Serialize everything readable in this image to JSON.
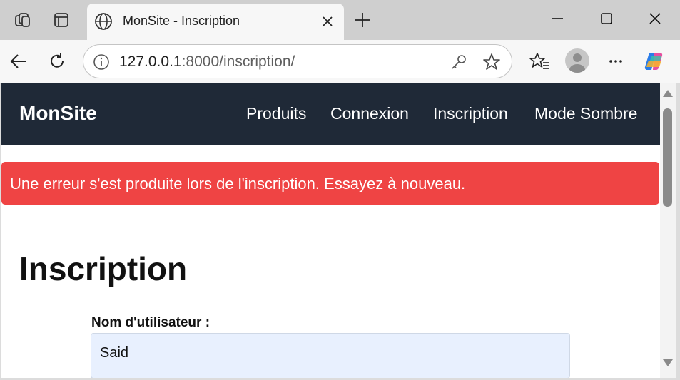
{
  "browser": {
    "tab": {
      "title": "MonSite - Inscription"
    },
    "address": {
      "host": "127.0.0.1",
      "rest": ":8000/inscription/"
    }
  },
  "site": {
    "brand": "MonSite",
    "nav": [
      {
        "label": "Produits"
      },
      {
        "label": "Connexion"
      },
      {
        "label": "Inscription"
      },
      {
        "label": "Mode Sombre"
      }
    ],
    "alert": {
      "text": "Une erreur s'est produite lors de l'inscription. Essayez à nouveau.",
      "color": "#ef4444"
    },
    "page_title": "Inscription",
    "form": {
      "username_label": "Nom d'utilisateur :",
      "username_value": "Said"
    }
  },
  "colors": {
    "navbar": "#1f2937",
    "input_bg": "#e8f0fe"
  }
}
